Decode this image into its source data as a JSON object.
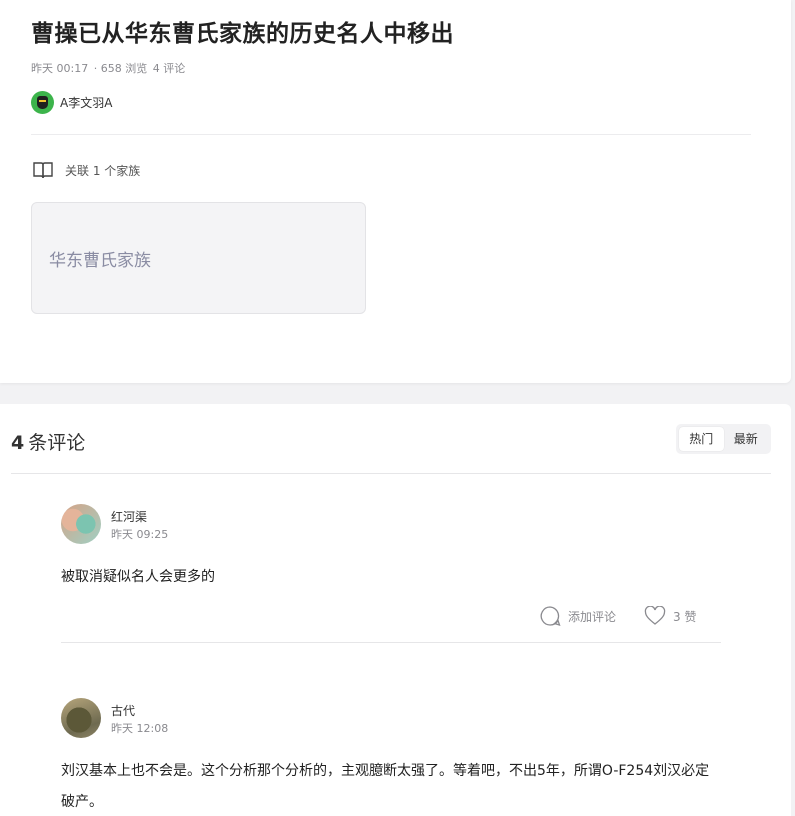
{
  "post": {
    "title": "曹操已从华东曹氏家族的历史名人中移出",
    "time": "昨天 00:17",
    "views": "· 658 浏览",
    "comments_count": "4 评论",
    "author": "A李文羽A"
  },
  "related": {
    "label": "关联 1 个家族",
    "families": [
      "华东曹氏家族"
    ]
  },
  "comments_section": {
    "count": "4",
    "label": "条评论",
    "tabs": [
      "热门",
      "最新"
    ],
    "active_tab": "热门"
  },
  "comments": [
    {
      "name": "红河渠",
      "time": "昨天 09:25",
      "text": "被取消疑似名人会更多的",
      "reply_label": "添加评论",
      "likes_label": "3 赞"
    },
    {
      "name": "古代",
      "time": "昨天 12:08",
      "text": "刘汉基本上也不会是。这个分析那个分析的，主观臆断太强了。等着吧，不出5年，所谓O-F254刘汉必定破产。"
    }
  ],
  "icons": {
    "related": "book-icon",
    "reply": "comment-bubble-icon",
    "like": "heart-icon"
  }
}
